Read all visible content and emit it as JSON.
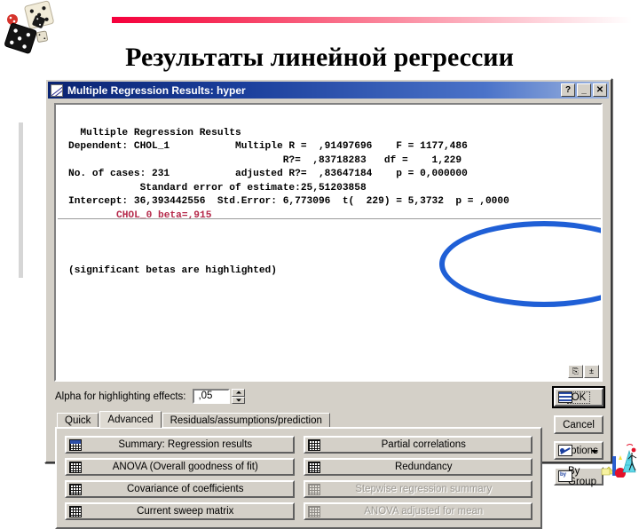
{
  "slide": {
    "title": "Результаты линейной регрессии",
    "accent_bar_color": "#f5003c",
    "dice_decoration": "dice-image",
    "clipart_decoration": "statistics-person-clipart"
  },
  "dialog": {
    "title": "Multiple Regression Results: hyper",
    "icon": "scatterplot-icon",
    "titlebar_buttons": [
      {
        "name": "help-button",
        "label": "?"
      },
      {
        "name": "minimize-button",
        "label": "_"
      },
      {
        "name": "close-button",
        "label": "✕"
      }
    ]
  },
  "results": {
    "heading": "  Multiple Regression Results",
    "lines": [
      {
        "left": "Dependent: ",
        "left_val": "CHOL_1",
        "right": "Multiple R = ",
        "right_val": ",91497696"
      },
      {
        "left": "",
        "left_val": "",
        "right": "R?= ",
        "right_val": ",83718283"
      },
      {
        "left": "No. of cases: ",
        "left_val": "231",
        "right": "adjusted R?= ",
        "right_val": ",83647184"
      }
    ],
    "text_block": "Dependent: CHOL_1           Multiple R =  ,91497696    F = 1177,486\n                                    R?=  ,83718283   df =    1,229\nNo. of cases: 231           adjusted R?=  ,83647184    p = 0,000000\n            Standard error of estimate:25,51203858\nIntercept: 36,393442556  Std.Error: 6,773096  t(  229) = 5,3732  p = ,0000",
    "beta_line": "CHOL_0 beta=,915",
    "footer_note": "(significant betas are highlighted)",
    "highlight_values": {
      "F": "1177,486",
      "df": "1,229",
      "p": "0,000000"
    },
    "copy_button": "⎘",
    "resize_button": "±"
  },
  "alpha": {
    "label": "Alpha for highlighting effects:",
    "value": ",05",
    "spinner_up": "spin-up-icon",
    "spinner_down": "spin-down-icon"
  },
  "tabs": [
    {
      "label": "Quick",
      "active": false
    },
    {
      "label": "Advanced",
      "active": true
    },
    {
      "label": "Residuals/assumptions/prediction",
      "active": false
    }
  ],
  "action_buttons": [
    {
      "label": "Summary:  Regression results",
      "disabled": false,
      "icon": "grid-blue-icon"
    },
    {
      "label": "Partial correlations",
      "disabled": false,
      "icon": "grid-icon"
    },
    {
      "label": "ANOVA (Overall goodness of fit)",
      "disabled": false,
      "icon": "grid-icon"
    },
    {
      "label": "Redundancy",
      "disabled": false,
      "icon": "grid-icon"
    },
    {
      "label": "Covariance of coefficients",
      "disabled": false,
      "icon": "grid-icon"
    },
    {
      "label": "Stepwise regression summary",
      "disabled": true,
      "icon": "grid-icon"
    },
    {
      "label": "Current sweep matrix",
      "disabled": false,
      "icon": "grid-icon"
    },
    {
      "label": "ANOVA adjusted for mean",
      "disabled": true,
      "icon": "grid-icon"
    }
  ],
  "side_buttons": {
    "ok": "OK",
    "cancel": "Cancel",
    "options": "Options",
    "by_group": "By Group"
  }
}
